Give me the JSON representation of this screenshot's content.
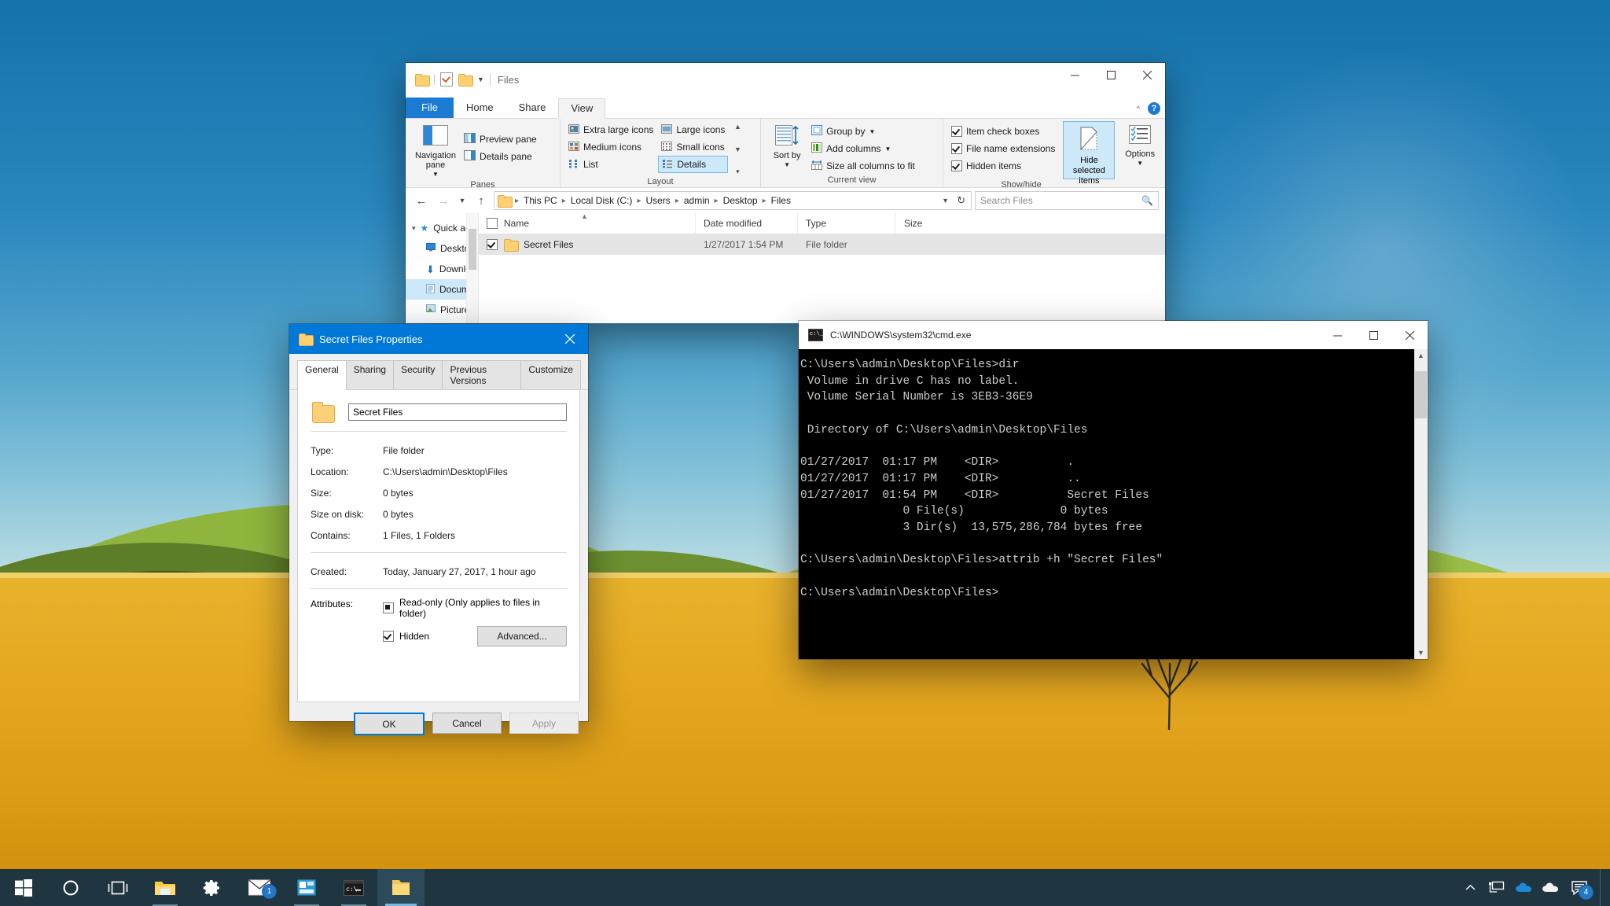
{
  "explorer": {
    "window_title": "Files",
    "quick_access_toolbar": [
      "folder-icon",
      "properties-icon",
      "new-folder-icon",
      "customize-caret"
    ],
    "window_buttons": [
      "minimize",
      "maximize",
      "close"
    ],
    "tabs": [
      {
        "label": "File",
        "kind": "file"
      },
      {
        "label": "Home",
        "kind": "normal"
      },
      {
        "label": "Share",
        "kind": "normal"
      },
      {
        "label": "View",
        "kind": "active"
      }
    ],
    "ribbon": {
      "groups": [
        {
          "label": "Panes",
          "big_button": "Navigation pane",
          "items": [
            "Preview pane",
            "Details pane"
          ]
        },
        {
          "label": "Layout",
          "items": [
            "Extra large icons",
            "Large icons",
            "Medium icons",
            "Small icons",
            "List",
            "Details"
          ],
          "selected": "Details"
        },
        {
          "label": "Current view",
          "big_button": "Sort by",
          "items": [
            "Group by",
            "Add columns",
            "Size all columns to fit"
          ]
        },
        {
          "label": "Show/hide",
          "checkboxes": [
            {
              "label": "Item check boxes",
              "checked": true
            },
            {
              "label": "File name extensions",
              "checked": true
            },
            {
              "label": "Hidden items",
              "checked": true
            }
          ],
          "toggle_button": "Hide selected items",
          "toggle_active": true,
          "options_button": "Options"
        }
      ]
    },
    "address": {
      "breadcrumbs": [
        "This PC",
        "Local Disk (C:)",
        "Users",
        "admin",
        "Desktop",
        "Files"
      ],
      "search_placeholder": "Search Files"
    },
    "nav_pane": {
      "root": "Quick access",
      "items": [
        {
          "label": "Desktop",
          "pinned": true,
          "selected": false
        },
        {
          "label": "Downloads",
          "pinned": true,
          "selected": false
        },
        {
          "label": "Documents",
          "pinned": true,
          "selected": true
        },
        {
          "label": "Pictures",
          "pinned": true,
          "selected": false
        }
      ]
    },
    "file_list": {
      "columns": [
        "Name",
        "Date modified",
        "Type",
        "Size"
      ],
      "rows": [
        {
          "name": "Secret Files",
          "date_modified": "1/27/2017 1:54 PM",
          "type": "File folder",
          "size": "",
          "checked": true,
          "selected": true
        }
      ]
    }
  },
  "properties": {
    "title": "Secret Files Properties",
    "tabs": [
      "General",
      "Sharing",
      "Security",
      "Previous Versions",
      "Customize"
    ],
    "active_tab": "General",
    "name_value": "Secret Files",
    "fields": [
      {
        "label": "Type:",
        "value": "File folder"
      },
      {
        "label": "Location:",
        "value": "C:\\Users\\admin\\Desktop\\Files"
      },
      {
        "label": "Size:",
        "value": "0 bytes"
      },
      {
        "label": "Size on disk:",
        "value": "0 bytes"
      },
      {
        "label": "Contains:",
        "value": "1 Files, 1 Folders"
      }
    ],
    "created_label": "Created:",
    "created_value": "Today, January 27, 2017, 1 hour ago",
    "attributes_label": "Attributes:",
    "attributes": [
      {
        "label": "Read-only (Only applies to files in folder)",
        "state": "indeterminate"
      },
      {
        "label": "Hidden",
        "state": "checked"
      }
    ],
    "advanced_button": "Advanced...",
    "buttons": [
      {
        "label": "OK",
        "style": "default"
      },
      {
        "label": "Cancel",
        "style": "normal"
      },
      {
        "label": "Apply",
        "style": "disabled"
      }
    ]
  },
  "cmd": {
    "title": "C:\\WINDOWS\\system32\\cmd.exe",
    "output": "C:\\Users\\admin\\Desktop\\Files>dir\n Volume in drive C has no label.\n Volume Serial Number is 3EB3-36E9\n\n Directory of C:\\Users\\admin\\Desktop\\Files\n\n01/27/2017  01:17 PM    <DIR>          .\n01/27/2017  01:17 PM    <DIR>          ..\n01/27/2017  01:54 PM    <DIR>          Secret Files\n               0 File(s)              0 bytes\n               3 Dir(s)  13,575,286,784 bytes free\n\nC:\\Users\\admin\\Desktop\\Files>attrib +h \"Secret Files\"\n\nC:\\Users\\admin\\Desktop\\Files>"
  },
  "taskbar": {
    "items": [
      {
        "name": "start-button",
        "icon": "windows-logo"
      },
      {
        "name": "cortana-search",
        "icon": "circle"
      },
      {
        "name": "task-view",
        "icon": "task-view"
      },
      {
        "name": "file-explorer",
        "icon": "folder",
        "open": true
      },
      {
        "name": "settings",
        "icon": "gear"
      },
      {
        "name": "mail",
        "icon": "envelope",
        "badge": "1"
      },
      {
        "name": "store",
        "icon": "store",
        "open": true
      },
      {
        "name": "command-prompt",
        "icon": "cmd",
        "open": true
      },
      {
        "name": "properties-window",
        "icon": "folder-yellow",
        "active": true
      }
    ],
    "tray": [
      {
        "name": "show-hidden-icons",
        "icon": "chevron-up"
      },
      {
        "name": "network",
        "icon": "network"
      },
      {
        "name": "onedrive-blue",
        "icon": "cloud"
      },
      {
        "name": "onedrive-white",
        "icon": "cloud"
      },
      {
        "name": "action-center",
        "icon": "speech-bubble",
        "badge": "4"
      }
    ]
  }
}
